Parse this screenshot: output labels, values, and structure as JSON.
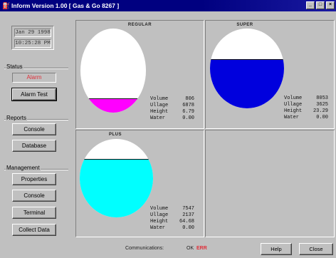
{
  "window": {
    "title": "Inform Version 1.00 [ Gas & Go 8267 ]",
    "app_icon": "tank-icon",
    "controls": {
      "minimize": "_",
      "maximize": "□",
      "close": "×"
    }
  },
  "sidebar": {
    "date": "Jan 29 1998",
    "time": "10:25:28 PM",
    "status": {
      "label": "Status",
      "value": "Alarm"
    },
    "alarm_test_label": "Alarm Test",
    "reports": {
      "label": "Reports",
      "items": [
        "Console",
        "Database"
      ]
    },
    "management": {
      "label": "Management",
      "items": [
        "Properties",
        "Console",
        "Terminal",
        "Collect Data"
      ]
    }
  },
  "tanks": [
    {
      "name": "REGULAR",
      "level": 0.16,
      "fill_color": "#ff00ff",
      "readouts": [
        {
          "label": "Volume",
          "value": "806"
        },
        {
          "label": "Ullage",
          "value": "6878"
        },
        {
          "label": "Height",
          "value": "6.79"
        },
        {
          "label": "Water",
          "value": "0.00"
        }
      ]
    },
    {
      "name": "SUPER",
      "level": 0.61,
      "fill_color": "#0000dd",
      "readouts": [
        {
          "label": "Volume",
          "value": "8053"
        },
        {
          "label": "Ullage",
          "value": "3625"
        },
        {
          "label": "Height",
          "value": "23.29"
        },
        {
          "label": "Water",
          "value": "0.00"
        }
      ]
    },
    {
      "name": "PLUS",
      "level": 0.74,
      "fill_color": "#00ffff",
      "readouts": [
        {
          "label": "Volume",
          "value": "7547"
        },
        {
          "label": "Ullage",
          "value": "2137"
        },
        {
          "label": "Height",
          "value": "64.68"
        },
        {
          "label": "Water",
          "value": "0.00"
        }
      ]
    }
  ],
  "footer": {
    "communications_label": "Communications:",
    "comm_ok": "OK",
    "comm_error": "ERR",
    "help_label": "Help",
    "close_label": "Close"
  }
}
